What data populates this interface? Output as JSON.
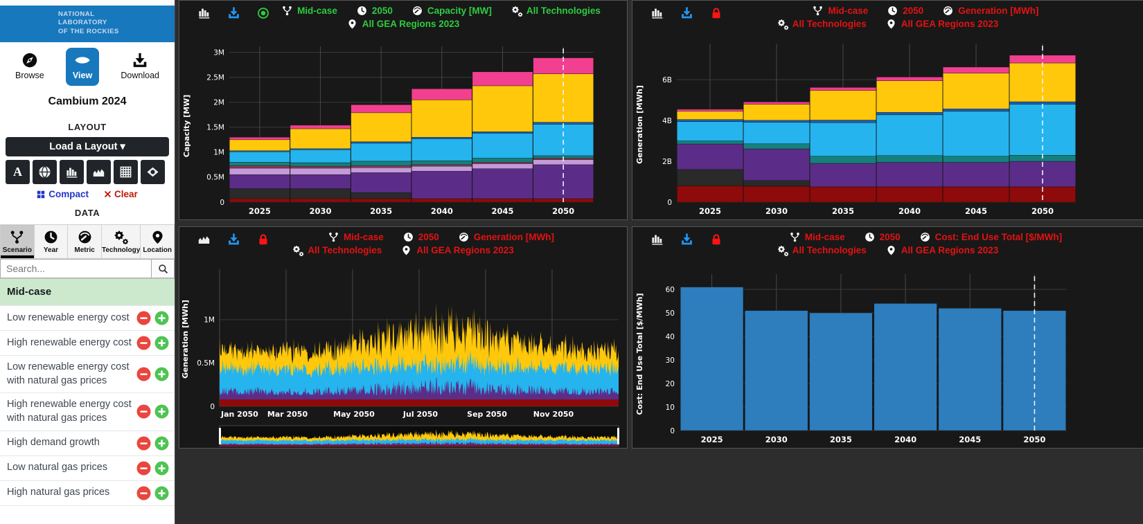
{
  "app": {
    "logo_lines": [
      "NATIONAL",
      "LABORATORY",
      "OF THE ROCKIES"
    ]
  },
  "sidebar": {
    "tabs": [
      {
        "label": "Browse",
        "icon": "compass-icon",
        "active": false
      },
      {
        "label": "View",
        "icon": "eye-icon",
        "active": true
      },
      {
        "label": "Download",
        "icon": "download-icon",
        "active": false
      }
    ],
    "dataset_title": "Cambium 2024",
    "layout_section": {
      "heading": "LAYOUT",
      "load_button_label": "Load a Layout ▾",
      "icon_buttons": [
        "text-layout",
        "globe-layout",
        "bar-chart-layout",
        "area-chart-layout",
        "grid-layout",
        "map-layout"
      ],
      "compact_label": "Compact",
      "clear_label": "Clear"
    },
    "data_section": {
      "heading": "DATA",
      "tabs": [
        {
          "label": "Scenario",
          "icon": "branch-icon",
          "active": true
        },
        {
          "label": "Year",
          "icon": "clock-icon",
          "active": false
        },
        {
          "label": "Metric",
          "icon": "gauge-icon",
          "active": false
        },
        {
          "label": "Technology",
          "icon": "gears-icon",
          "active": false
        },
        {
          "label": "Location",
          "icon": "pin-icon",
          "active": false
        }
      ],
      "search_placeholder": "Search...",
      "scenarios": [
        {
          "label": "Mid-case",
          "selected": true
        },
        {
          "label": "Low renewable energy cost",
          "selected": false
        },
        {
          "label": "High renewable energy cost",
          "selected": false
        },
        {
          "label": "Low renewable energy cost with natural gas prices",
          "selected": false
        },
        {
          "label": "High renewable energy cost with natural gas prices",
          "selected": false
        },
        {
          "label": "High demand growth",
          "selected": false
        },
        {
          "label": "Low natural gas prices",
          "selected": false
        },
        {
          "label": "High natural gas prices",
          "selected": false
        }
      ]
    }
  },
  "panels": [
    {
      "toolbar": {
        "accent": "#2ecc40",
        "state_icon": "record",
        "chart_icon": "bar-chart",
        "scenario": "Mid-case",
        "year": "2050",
        "metric": "Capacity [MW]",
        "technology": "All Technologies",
        "location": "All GEA Regions 2023"
      }
    },
    {
      "toolbar": {
        "accent": "#e31212",
        "state_icon": "lock",
        "chart_icon": "bar-chart",
        "scenario": "Mid-case",
        "year": "2050",
        "metric": "Generation [MWh]",
        "technology": "All Technologies",
        "location": "All GEA Regions 2023"
      }
    },
    {
      "toolbar": {
        "accent": "#e31212",
        "state_icon": "lock",
        "chart_icon": "area-chart",
        "scenario": "Mid-case",
        "year": "2050",
        "metric": "Generation [MWh]",
        "technology": "All Technologies",
        "location": "All GEA Regions 2023"
      }
    },
    {
      "toolbar": {
        "accent": "#e31212",
        "state_icon": "lock",
        "chart_icon": "bar-chart",
        "scenario": "Mid-case",
        "year": "2050",
        "metric": "Cost: End Use Total [$/MWh]",
        "technology": "All Technologies",
        "location": "All GEA Regions 2023"
      }
    }
  ],
  "chart_data": [
    {
      "type": "bar",
      "stacked": true,
      "title": "Capacity by technology, Mid-case",
      "ylabel": "Capacity [MW]",
      "unit": "M",
      "ylim": [
        0,
        3.05
      ],
      "yticks": [
        [
          0,
          "0"
        ],
        [
          0.5,
          "0.5M"
        ],
        [
          1,
          "1M"
        ],
        [
          1.5,
          "1.5M"
        ],
        [
          2,
          "2M"
        ],
        [
          2.5,
          "2.5M"
        ],
        [
          3,
          "3M"
        ]
      ],
      "categories": [
        2025,
        2030,
        2035,
        2040,
        2045,
        2050
      ],
      "xrange": [
        2022.5,
        2052.5
      ],
      "bar_span": 5,
      "cursor_x": 2050,
      "grid": true,
      "series": [
        {
          "name": "dark-red",
          "color": "#8f0a0a",
          "values": [
            0.07,
            0.07,
            0.07,
            0.07,
            0.07,
            0.07
          ]
        },
        {
          "name": "charcoal",
          "color": "#2a2a2a",
          "values": [
            0.2,
            0.2,
            0.12,
            0,
            0,
            0
          ]
        },
        {
          "name": "purple",
          "color": "#5c2d88",
          "values": [
            0.28,
            0.28,
            0.4,
            0.55,
            0.6,
            0.68
          ]
        },
        {
          "name": "lavender",
          "color": "#c49bd8",
          "values": [
            0.13,
            0.13,
            0.1,
            0.1,
            0.1,
            0.1
          ]
        },
        {
          "name": "maroon",
          "color": "#8a3a5e",
          "values": [
            0.05,
            0.04,
            0.04,
            0.03,
            0.03,
            0.03
          ]
        },
        {
          "name": "teal",
          "color": "#15807c",
          "values": [
            0.07,
            0.07,
            0.09,
            0.08,
            0.08,
            0.05
          ]
        },
        {
          "name": "cyan",
          "color": "#25b4ee",
          "values": [
            0.21,
            0.26,
            0.36,
            0.44,
            0.5,
            0.63
          ]
        },
        {
          "name": "navy",
          "color": "#1b61b3",
          "values": [
            0.02,
            0.02,
            0.03,
            0.03,
            0.03,
            0.04
          ]
        },
        {
          "name": "yellow",
          "color": "#ffc80a",
          "values": [
            0.22,
            0.4,
            0.58,
            0.75,
            0.92,
            0.97
          ]
        },
        {
          "name": "pink",
          "color": "#f23f90",
          "values": [
            0.05,
            0.07,
            0.16,
            0.22,
            0.28,
            0.32
          ]
        }
      ]
    },
    {
      "type": "bar",
      "stacked": true,
      "title": "Generation by technology, Mid-case",
      "ylabel": "Generation [MWh]",
      "unit": "B",
      "ylim": [
        0,
        7.6
      ],
      "yticks": [
        [
          0,
          "0"
        ],
        [
          2,
          "2B"
        ],
        [
          4,
          "4B"
        ],
        [
          6,
          "6B"
        ]
      ],
      "categories": [
        2025,
        2030,
        2035,
        2040,
        2045,
        2050
      ],
      "xrange": [
        2022.5,
        2052.5
      ],
      "bar_span": 5,
      "cursor_x": 2050,
      "grid": true,
      "series": [
        {
          "name": "dark-red",
          "color": "#8f0a0a",
          "values": [
            0.8,
            0.78,
            0.75,
            0.75,
            0.75,
            0.75
          ]
        },
        {
          "name": "charcoal",
          "color": "#2a2a2a",
          "values": [
            0.8,
            0.28,
            0,
            0,
            0,
            0
          ]
        },
        {
          "name": "purple",
          "color": "#5c2d88",
          "values": [
            1.25,
            1.55,
            1.15,
            1.2,
            1.2,
            1.25
          ]
        },
        {
          "name": "teal",
          "color": "#15807c",
          "values": [
            0.15,
            0.25,
            0.35,
            0.33,
            0.3,
            0.3
          ]
        },
        {
          "name": "cyan",
          "color": "#25b4ee",
          "values": [
            0.95,
            1.05,
            1.65,
            2.0,
            2.2,
            2.5
          ]
        },
        {
          "name": "navy",
          "color": "#1b61b3",
          "values": [
            0.1,
            0.1,
            0.12,
            0.12,
            0.12,
            0.12
          ]
        },
        {
          "name": "yellow",
          "color": "#ffc80a",
          "values": [
            0.4,
            0.78,
            1.45,
            1.55,
            1.75,
            1.9
          ]
        },
        {
          "name": "pink",
          "color": "#f23f90",
          "values": [
            0.1,
            0.12,
            0.15,
            0.18,
            0.3,
            0.38
          ]
        }
      ]
    },
    {
      "type": "area",
      "hourly": true,
      "title": "Hourly generation, 2050, Mid-case",
      "ylabel": "Generation [MWh]",
      "unit": "M",
      "ylim": [
        0,
        1.55
      ],
      "yticks": [
        [
          0,
          "0"
        ],
        [
          0.5,
          "0.5M"
        ],
        [
          1,
          "1M"
        ]
      ],
      "x_labels": [
        "Jan 2050",
        "Mar 2050",
        "May 2050",
        "Jul 2050",
        "Sep 2050",
        "Nov 2050"
      ],
      "samples": 620,
      "seed": 1234,
      "navigator": true,
      "layers": [
        {
          "name": "dark-red",
          "color": "#8f0a0a",
          "base": 0.08,
          "noise": 0,
          "seasonal": 0
        },
        {
          "name": "purple",
          "color": "#5c2d88",
          "base": 0.05,
          "noise": 0.18,
          "seasonal": 0.65
        },
        {
          "name": "cyan",
          "color": "#25b4ee",
          "base": 0.2,
          "noise": 0.26,
          "seasonal": 0
        },
        {
          "name": "yellow",
          "color": "#ffc80a",
          "base": 0.14,
          "noise": 0.3,
          "seasonal": 1.0
        }
      ]
    },
    {
      "type": "bar",
      "stacked": false,
      "title": "Cost: End Use Total, Mid-case",
      "ylabel": "Cost: End Use Total [$/MWh]",
      "unit": "",
      "ylim": [
        0,
        65
      ],
      "yticks": [
        [
          0,
          "0"
        ],
        [
          10,
          "10"
        ],
        [
          20,
          "20"
        ],
        [
          30,
          "30"
        ],
        [
          40,
          "40"
        ],
        [
          50,
          "50"
        ],
        [
          60,
          "60"
        ]
      ],
      "categories": [
        2025,
        2030,
        2035,
        2040,
        2045,
        2050
      ],
      "xrange": [
        2022.5,
        2052.5
      ],
      "bar_span": 5,
      "cursor_x": 2050,
      "grid": true,
      "series": [
        {
          "name": "cost-end-use-total",
          "color": "#2e7dbc",
          "values": [
            61,
            51,
            50,
            54,
            52,
            51
          ]
        }
      ]
    }
  ]
}
